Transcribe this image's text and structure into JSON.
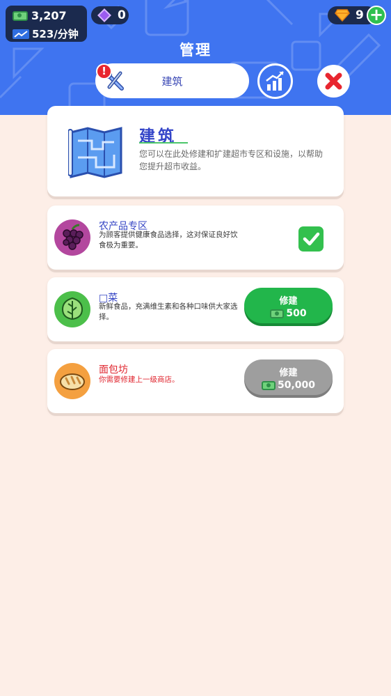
{
  "currency": {
    "cash": "3,207",
    "rate": "523/分钟",
    "gems": "0",
    "diamonds": "9"
  },
  "header": {
    "title": "管理",
    "tab_build_label": "建筑",
    "alert": "!"
  },
  "intro": {
    "title": "建筑",
    "description": "您可以在此处修建和扩建超市专区和设施，以帮助您提升超市收益。"
  },
  "items": [
    {
      "title": "农产品专区",
      "description": "为顾客提供健康食品选择，这对保证良好饮食极为重要。",
      "status": "built"
    },
    {
      "title": "□菜",
      "description": "新鲜食品，充满维生素和各种口味供大家选择。",
      "button_label": "修建",
      "price": "500",
      "status": "available"
    },
    {
      "title": "面包坊",
      "description": "你需要修建上一级商店。",
      "button_label": "修建",
      "price": "50,000",
      "status": "locked"
    }
  ],
  "colors": {
    "header_bg": "#3f74f0",
    "page_bg": "#fdeee7",
    "build_green": "#22b64b",
    "locked_gray": "#9e9e9e",
    "locked_text": "#e0262f"
  },
  "icons": {
    "cash": "cash-icon",
    "rate": "income-rate-icon",
    "gem": "gem-icon",
    "diamond": "diamond-icon",
    "build_tab": "tools-icon",
    "stats_tab": "stats-chart-icon",
    "close": "close-icon",
    "intro": "blueprint-map-icon",
    "produce": "grapes-icon",
    "vegetable": "lettuce-icon",
    "bakery": "bread-icon"
  }
}
